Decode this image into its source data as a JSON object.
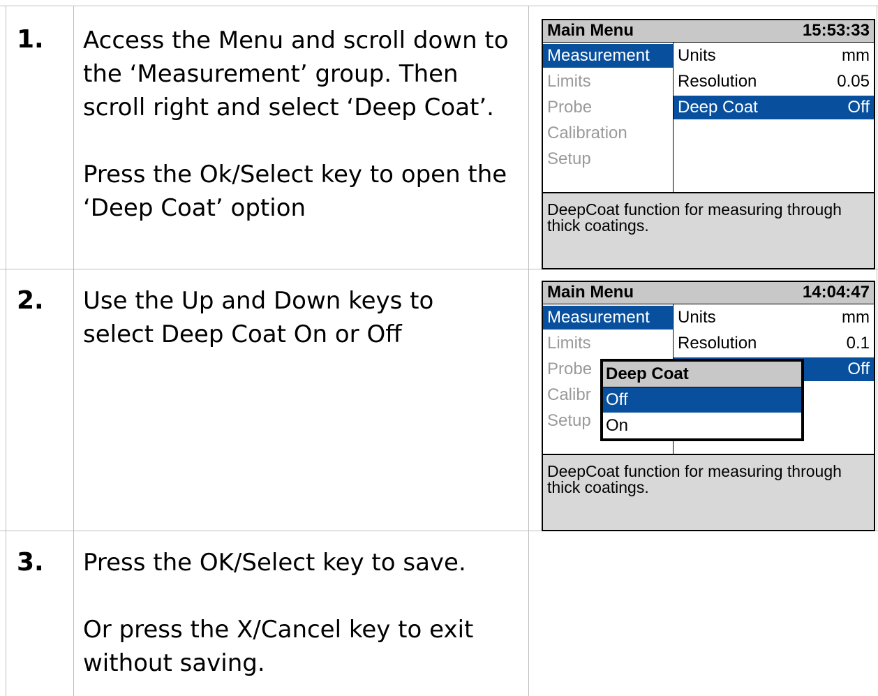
{
  "steps": [
    {
      "number": "1.",
      "paragraphs": [
        "Access the Menu and scroll down to the ‘Measurement’ group. Then scroll right and select ‘Deep Coat’.",
        "Press the Ok/Select key to open the ‘Deep Coat’ option"
      ]
    },
    {
      "number": "2.",
      "paragraphs": [
        "Use the Up and Down keys to select Deep Coat On or Off"
      ]
    },
    {
      "number": "3.",
      "paragraphs": [
        "Press the OK/Select key to save.",
        "Or press the X/Cancel key to exit without saving."
      ]
    }
  ],
  "screen1": {
    "title": "Main Menu",
    "clock": "15:53:33",
    "menu": [
      "Measurement",
      "Limits",
      "Probe",
      "Calibration",
      "Setup"
    ],
    "settings": [
      {
        "name": "Units",
        "value": "mm"
      },
      {
        "name": "Resolution",
        "value": "0.05"
      },
      {
        "name": "Deep Coat",
        "value": "Off"
      }
    ],
    "description": "DeepCoat function for measuring through thick coatings."
  },
  "screen2": {
    "title": "Main Menu",
    "clock": "14:04:47",
    "menu": [
      "Measurement",
      "Limits",
      "Probe",
      "Calibr",
      "Setup"
    ],
    "settings": [
      {
        "name": "Units",
        "value": "mm"
      },
      {
        "name": "Resolution",
        "value": "0.1"
      },
      {
        "name": "",
        "value": "Off"
      }
    ],
    "popup": {
      "title": "Deep Coat",
      "options": [
        "Off",
        "On"
      ]
    },
    "description": "DeepCoat function for measuring through thick coatings."
  },
  "colors": {
    "selection": "#08509e",
    "header_bg": "#c8c8c8",
    "footer_bg": "#d8d8d8",
    "inactive_text": "#9a9a9a",
    "grid": "#bdbdbd"
  }
}
